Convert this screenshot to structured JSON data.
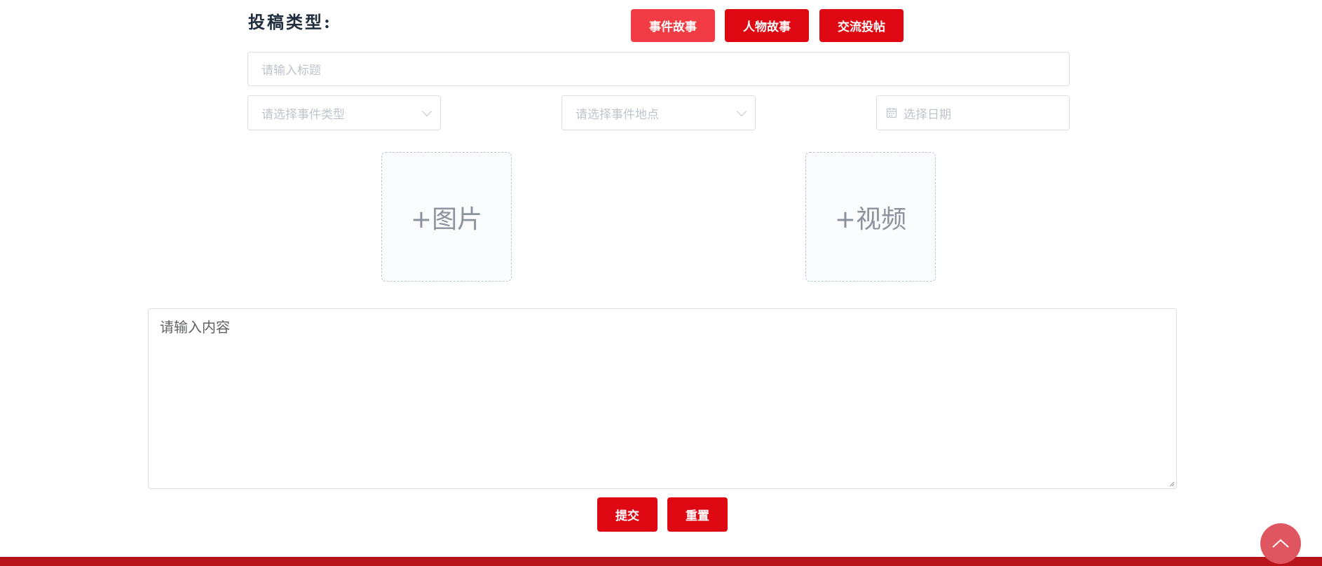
{
  "submission": {
    "type_label": "投稿类型:",
    "types": [
      "事件故事",
      "人物故事",
      "交流投帖"
    ],
    "selected_type": "事件故事"
  },
  "form": {
    "title_placeholder": "请输入标题",
    "event_type_placeholder": "请选择事件类型",
    "event_location_placeholder": "请选择事件地点",
    "date_placeholder": "选择日期",
    "image_upload_label": "+图片",
    "video_upload_label": "+视频",
    "content_placeholder": "请输入内容"
  },
  "actions": {
    "submit_label": "提交",
    "reset_label": "重置"
  },
  "colors": {
    "primary_red": "#de0813",
    "active_red": "#f23c45",
    "footer_red": "#b8141c",
    "back_top": "#e05660"
  },
  "icons": {
    "calendar": "calendar-icon",
    "dropdown": "chevron-down-icon",
    "back_to_top": "chevron-up-icon"
  }
}
